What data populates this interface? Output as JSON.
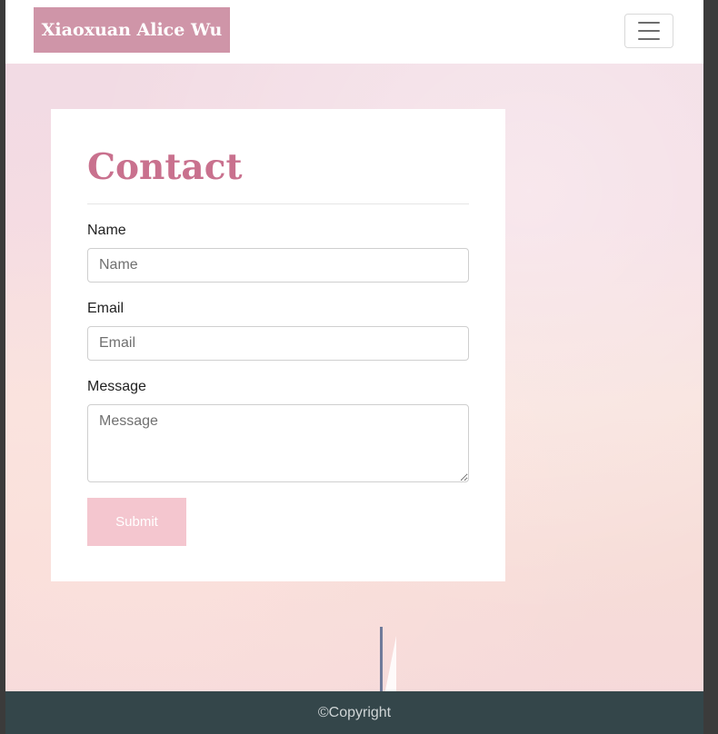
{
  "navbar": {
    "brand": "Xiaoxuan Alice Wu",
    "toggler_icon": "hamburger-menu-icon"
  },
  "contact": {
    "title": "Contact",
    "name_label": "Name",
    "name_placeholder": "Name",
    "email_label": "Email",
    "email_placeholder": "Email",
    "message_label": "Message",
    "message_placeholder": "Message",
    "submit_label": "Submit"
  },
  "footer": {
    "copyright": "©Copyright"
  },
  "colors": {
    "brand_bg": "#cf95a8",
    "title": "#c9718e",
    "submit_bg": "#f4c6cf",
    "footer_bg": "#34464a"
  }
}
